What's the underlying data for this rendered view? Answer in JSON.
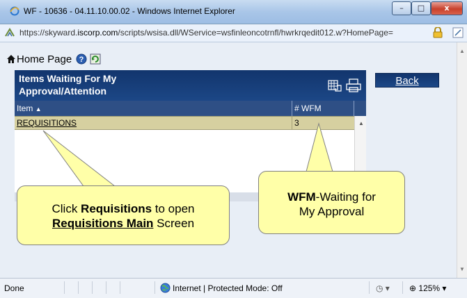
{
  "window": {
    "title": "WF - 10636 - 04.11.10.00.02 - Windows Internet Explorer",
    "controls": {
      "minimize": "–",
      "maximize": "□",
      "close": "x"
    }
  },
  "address": {
    "url_prefix": "https://skyward.",
    "url_domain": "iscorp.com",
    "url_suffix": "/scripts/wsisa.dll/WService=wsfinleoncotrnfl/hwrkrqedit012.w?HomePage="
  },
  "toolbar": {
    "home_label": "Home Page"
  },
  "panel": {
    "title": "Items Waiting For My Approval/Attention",
    "back_label": "Back",
    "columns": [
      "Item",
      "# WFM"
    ],
    "sort_indicator": "▲",
    "rows": [
      {
        "item": "REQUISITIONS",
        "wfm": "3"
      }
    ]
  },
  "callouts": {
    "requisitions": {
      "pre": "Click ",
      "bold1": "Requisitions",
      "mid": " to open",
      "bold2": "Requisitions Main",
      "post": " Screen"
    },
    "wfm": {
      "bold": "WFM",
      "rest1": "-Waiting for",
      "rest2": "My Approval"
    }
  },
  "status": {
    "text": "Done",
    "zone": "Internet | Protected Mode: Off",
    "zoom": "125%"
  },
  "colors": {
    "panel_header": "#12356d",
    "row_highlight": "#d6d0a0",
    "callout": "#ffffa8"
  }
}
